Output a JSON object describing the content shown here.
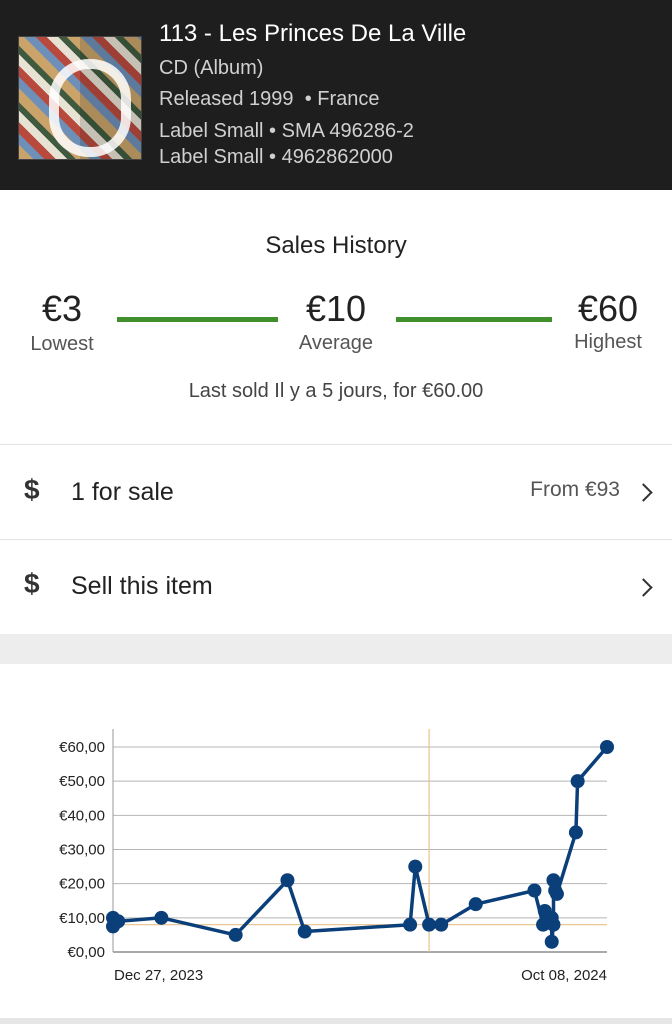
{
  "header": {
    "title": "113 - Les Princes De La Ville",
    "format": "CD (Album)",
    "released": "Released 1999",
    "country": "• France",
    "label_line_1": "Label Small • SMA 496286-2",
    "label_line_2": "Label Small • 4962862000"
  },
  "sales_history": {
    "title": "Sales History",
    "lowest_value": "€3",
    "lowest_label": "Lowest",
    "average_value": "€10",
    "average_label": "Average",
    "highest_value": "€60",
    "highest_label": "Highest",
    "last_sold": "Last sold Il y a 5 jours, for €60.00"
  },
  "for_sale": {
    "icon": "dollar-icon",
    "label": "1 for sale",
    "from": "From €93"
  },
  "sell": {
    "icon": "dollar-icon",
    "label": "Sell this item"
  },
  "colors": {
    "header_bg": "#1e1e1e",
    "range_bar": "#3f8f2c",
    "line": "#0b3f7a",
    "average_line": "#e8c188"
  },
  "chart_data": {
    "type": "line",
    "y_tick_labels": [
      "€0,00",
      "€10,00",
      "€20,00",
      "€30,00",
      "€40,00",
      "€50,00",
      "€60,00"
    ],
    "x_tick_labels": [
      "Dec 27, 2023",
      "Oct 08, 2024"
    ],
    "ylim": [
      0,
      60
    ],
    "average": 8,
    "x": [
      "2023-12-27",
      "2023-12-27",
      "2023-12-30",
      "2024-01-24",
      "2024-03-07",
      "2024-04-06",
      "2024-04-16",
      "2024-06-16",
      "2024-06-19",
      "2024-06-27",
      "2024-07-04",
      "2024-07-24",
      "2024-08-27",
      "2024-09-01",
      "2024-09-02",
      "2024-09-06",
      "2024-09-06",
      "2024-09-07",
      "2024-09-07",
      "2024-09-08",
      "2024-09-09",
      "2024-09-20",
      "2024-09-21",
      "2024-10-08"
    ],
    "values": [
      7.5,
      10,
      9,
      10,
      5,
      21,
      6,
      8,
      25,
      8,
      8,
      14,
      18,
      8,
      12,
      10,
      3,
      8,
      21,
      18,
      17,
      35,
      50,
      60
    ]
  }
}
